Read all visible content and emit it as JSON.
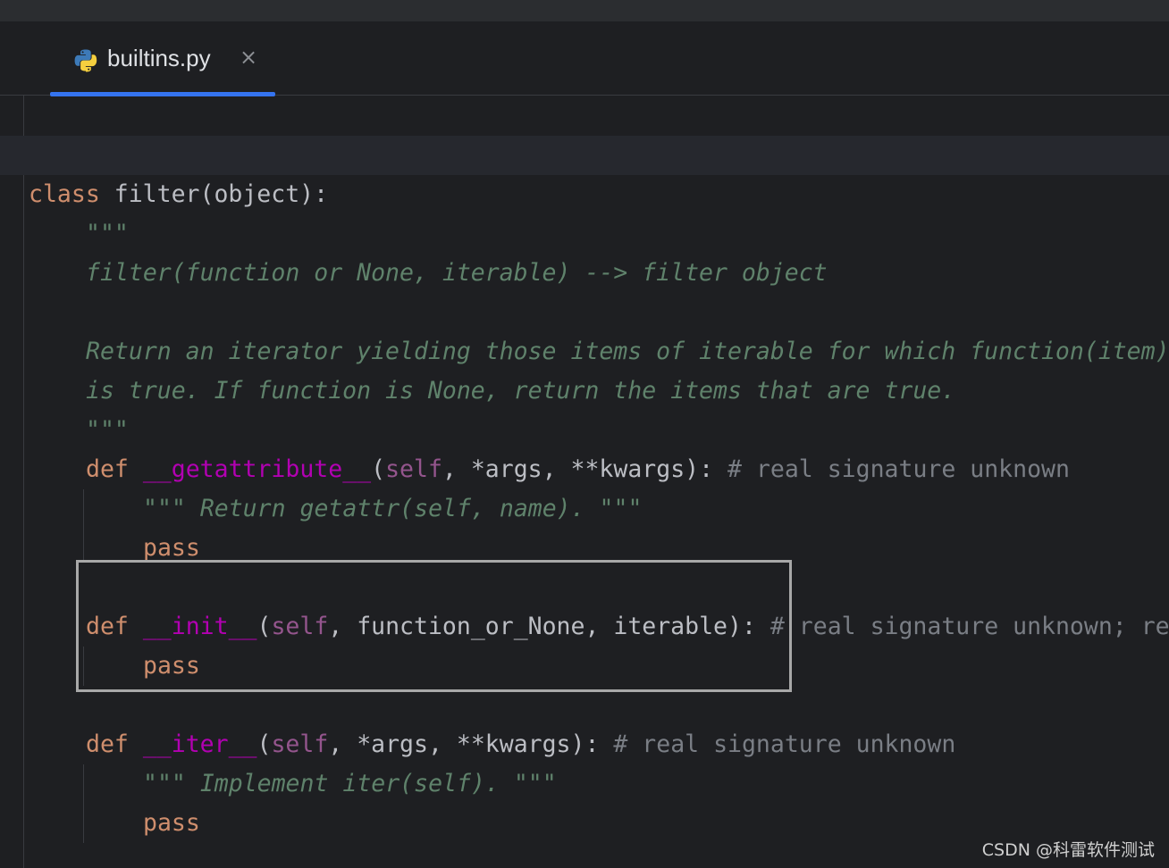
{
  "tab": {
    "filename": "builtins.py",
    "icon": "python-icon",
    "close_icon": "close-icon",
    "active_color": "#3574f0"
  },
  "code": {
    "l1": {
      "kw": "class",
      "name": "filter",
      "rest": "(object):"
    },
    "l2": {
      "doc": "\"\"\""
    },
    "l3": {
      "doc": "filter(function or None, iterable) --> filter object"
    },
    "l5": {
      "doc": "Return an iterator yielding those items of iterable for which function(item)"
    },
    "l6": {
      "doc": "is true. If function is None, return the items that are true."
    },
    "l7": {
      "doc": "\"\"\""
    },
    "l8": {
      "kw": "def",
      "name": "__getattribute__",
      "open": "(",
      "self": "self",
      "args": ", *args, **kwargs):",
      "comment": "# real signature unknown"
    },
    "l9": {
      "doc": "\"\"\" Return getattr(self, name). \"\"\""
    },
    "l10": {
      "kw": "pass"
    },
    "l12": {
      "kw": "def",
      "name": "__init__",
      "open": "(",
      "self": "self",
      "args": ", function_or_None, iterable):",
      "comment": "# real signature unknown; re"
    },
    "l13": {
      "kw": "pass"
    },
    "l15": {
      "kw": "def",
      "name": "__iter__",
      "open": "(",
      "self": "self",
      "args": ", *args, **kwargs):",
      "comment": "# real signature unknown"
    },
    "l16": {
      "doc": "\"\"\" Implement iter(self). \"\"\""
    },
    "l17": {
      "kw": "pass"
    }
  },
  "colors": {
    "keyword": "#cf8e6d",
    "magic_method": "#b200b2",
    "self": "#94558d",
    "docstring": "#5f826b",
    "comment": "#7a7e85",
    "background": "#1e1f22"
  },
  "watermark": "CSDN @科雷软件测试"
}
